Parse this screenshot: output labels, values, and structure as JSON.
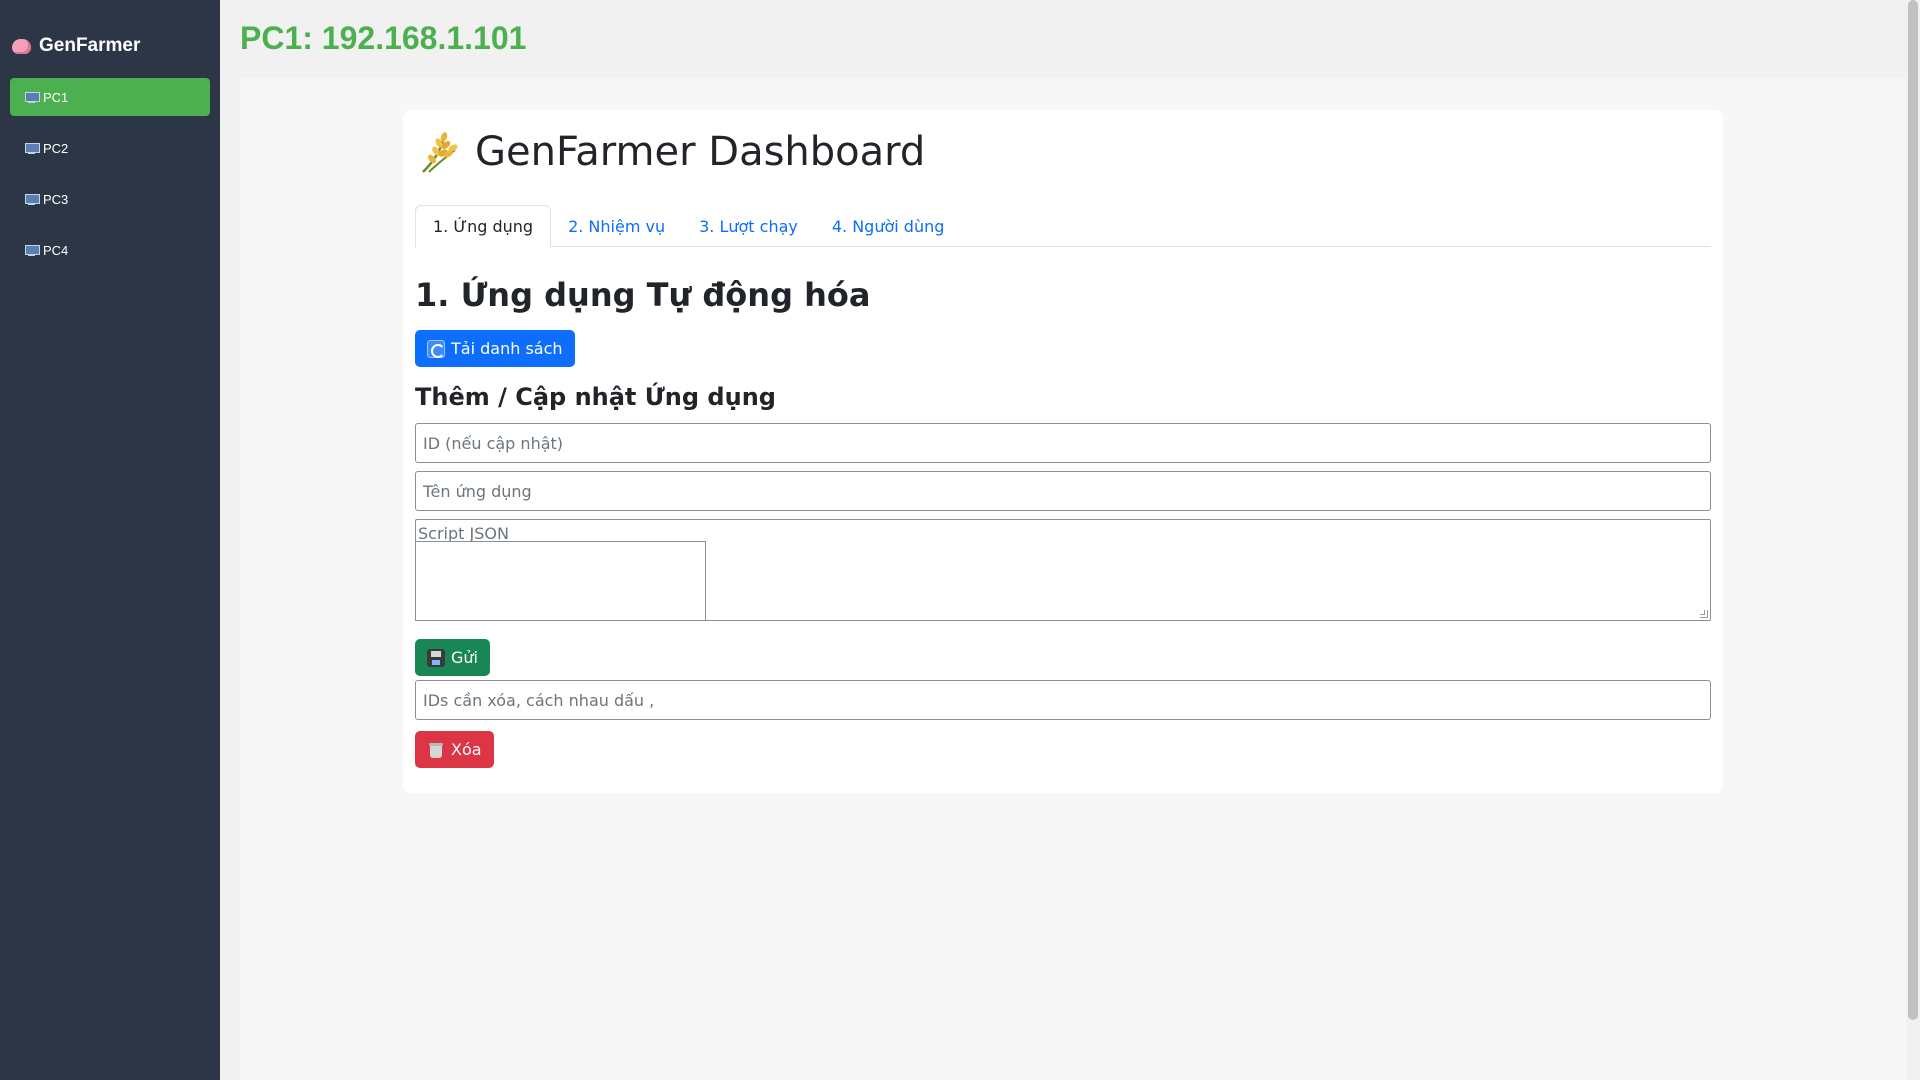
{
  "sidebar": {
    "brand": {
      "icon": "brain-icon",
      "label": "GenFarmer"
    },
    "items": [
      {
        "icon": "computer-icon",
        "label": "PC1",
        "active": true
      },
      {
        "icon": "computer-icon",
        "label": "PC2",
        "active": false
      },
      {
        "icon": "computer-icon",
        "label": "PC3",
        "active": false
      },
      {
        "icon": "computer-icon",
        "label": "PC4",
        "active": false
      }
    ]
  },
  "header": {
    "title": "PC1: 192.168.1.101"
  },
  "dashboard": {
    "icon": "wheat-icon",
    "title": "GenFarmer Dashboard",
    "tabs": [
      {
        "label": "1. Ứng dụng",
        "active": true
      },
      {
        "label": "2. Nhiệm vụ",
        "active": false
      },
      {
        "label": "3. Lượt chạy",
        "active": false
      },
      {
        "label": "4. Người dùng",
        "active": false
      }
    ],
    "section_title": "1. Ứng dụng Tự động hóa",
    "reload_button": "Tải danh sách",
    "form_title": "Thêm / Cập nhật Ứng dụng",
    "id_placeholder": "ID (nếu cập nhật)",
    "name_placeholder": "Tên ứng dụng",
    "script_placeholder": "Script JSON",
    "send_button": "Gửi",
    "delete_placeholder": "IDs cần xóa, cách nhau dấu ,",
    "delete_button": "Xóa"
  },
  "colors": {
    "sidebar_bg": "#2c3646",
    "accent_green": "#4caf50",
    "primary_blue": "#0d6efd",
    "success_green": "#198754",
    "danger_red": "#dc3545"
  }
}
